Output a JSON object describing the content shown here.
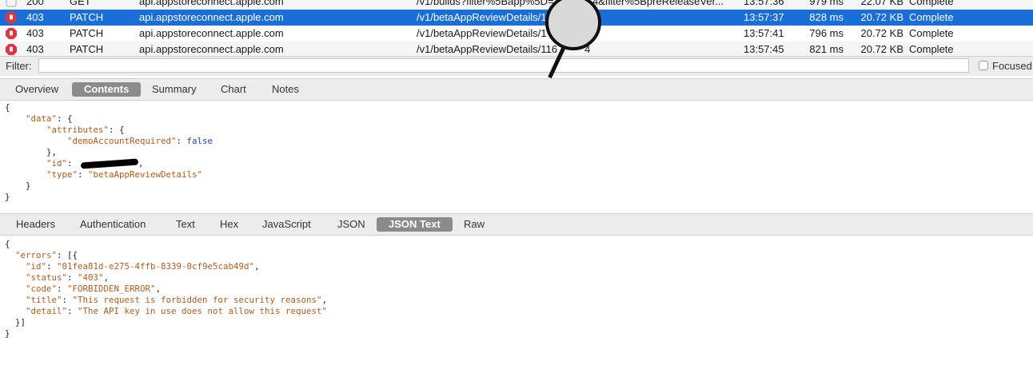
{
  "requests": [
    {
      "code": "200",
      "method": "GET",
      "host": "api.appstoreconnect.apple.com",
      "path": "/v1/builds?filter%5Bapp%5D=1",
      "mid": "4&filter%5BpreReleaseVer...",
      "time": "13:57:36",
      "duration": "979 ms",
      "size": "22.07 KB",
      "status": "Complete",
      "icon": "info-icon"
    },
    {
      "code": "403",
      "method": "PATCH",
      "host": "api.appstoreconnect.apple.com",
      "path": "/v1/betaAppReviewDetails/1",
      "mid": "",
      "time": "13:57:37",
      "duration": "828 ms",
      "size": "20.72 KB",
      "status": "Complete",
      "icon": "stop-hand-icon"
    },
    {
      "code": "403",
      "method": "PATCH",
      "host": "api.appstoreconnect.apple.com",
      "path": "/v1/betaAppReviewDetails/1",
      "mid": "",
      "time": "13:57:41",
      "duration": "796 ms",
      "size": "20.72 KB",
      "status": "Complete",
      "icon": "stop-hand-icon"
    },
    {
      "code": "403",
      "method": "PATCH",
      "host": "api.appstoreconnect.apple.com",
      "path": "/v1/betaAppReviewDetails/116",
      "mid": "4",
      "time": "13:57:45",
      "duration": "821 ms",
      "size": "20.72 KB",
      "status": "Complete",
      "icon": "stop-hand-icon"
    }
  ],
  "filter": {
    "label": "Filter:",
    "value": "",
    "placeholder": "",
    "focused_label": "Focused"
  },
  "request_tabs": [
    "Overview",
    "Contents",
    "Summary",
    "Chart",
    "Notes"
  ],
  "request_active_tab": "Contents",
  "request_body": {
    "l0": "{",
    "k_data": "\"data\"",
    "k_attributes": "\"attributes\"",
    "k_demo": "\"demoAccountRequired\"",
    "v_demo": "false",
    "k_id": "\"id\"",
    "k_type": "\"type\"",
    "v_type": "\"betaAppReviewDetails\"",
    "l_end": "}"
  },
  "response_tabs": [
    "Headers",
    "Authentication",
    "Text",
    "Hex",
    "JavaScript",
    "JSON",
    "JSON Text",
    "Raw"
  ],
  "response_active_tab": "JSON Text",
  "response_body": {
    "k_errors": "\"errors\"",
    "k_id": "\"id\"",
    "v_id": "\"01fea81d-e275-4ffb-8339-0cf9e5cab49d\"",
    "k_status": "\"status\"",
    "v_status": "\"403\"",
    "k_code": "\"code\"",
    "v_code": "\"FORBIDDEN_ERROR\"",
    "k_title": "\"title\"",
    "v_title": "\"This request is forbidden for security reasons\"",
    "k_detail": "\"detail\"",
    "v_detail": "\"The API key in use does not allow this request\""
  },
  "colors": {
    "selection": "#1a6ed8",
    "json_string": "#b85a16",
    "json_bool": "#2b3fc9",
    "active_tab": "#8b8b8b",
    "error_icon": "#e0343f"
  }
}
